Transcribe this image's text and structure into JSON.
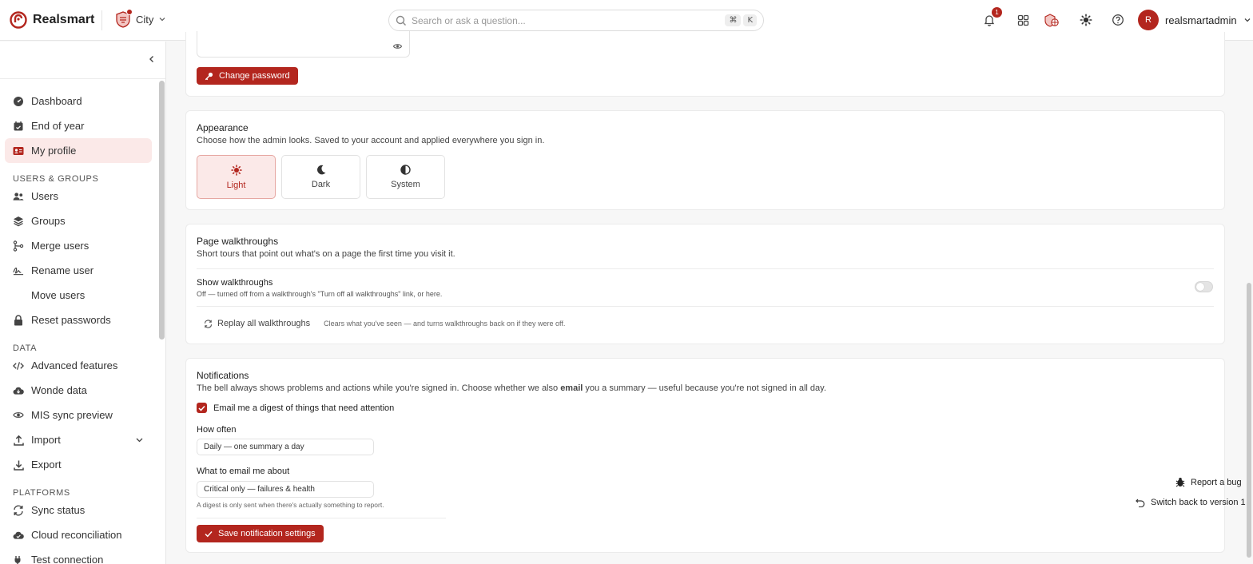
{
  "colors": {
    "accent": "#b3261e",
    "accent_light": "#fbe9e8"
  },
  "header": {
    "brand": "Realsmart",
    "school": "City",
    "search_placeholder": "Search or ask a question...",
    "shortcut_keys": [
      "⌘",
      "K"
    ],
    "notification_count": "1",
    "avatar_initial": "R",
    "username": "realsmartadmin"
  },
  "sidebar": {
    "items_top": [
      {
        "label": "Dashboard",
        "icon": "gauge-icon"
      },
      {
        "label": "End of year",
        "icon": "calendar-check-icon"
      },
      {
        "label": "My profile",
        "icon": "id-card-icon",
        "active": true
      }
    ],
    "section_users": "USERS & GROUPS",
    "items_users": [
      {
        "label": "Users",
        "icon": "users-icon"
      },
      {
        "label": "Groups",
        "icon": "layers-icon"
      },
      {
        "label": "Merge users",
        "icon": "merge-icon"
      },
      {
        "label": "Rename user",
        "icon": "signature-icon"
      },
      {
        "label": "Move users",
        "icon": ""
      },
      {
        "label": "Reset passwords",
        "icon": "lock-icon"
      }
    ],
    "section_data": "DATA",
    "items_data": [
      {
        "label": "Advanced features",
        "icon": "code-icon"
      },
      {
        "label": "Wonde data",
        "icon": "cloud-download-icon"
      },
      {
        "label": "MIS sync preview",
        "icon": "eye-icon"
      },
      {
        "label": "Import",
        "icon": "upload-icon"
      },
      {
        "label": "Export",
        "icon": "download-icon"
      }
    ],
    "section_platforms": "PLATFORMS",
    "items_platforms": [
      {
        "label": "Sync status",
        "icon": "sync-icon"
      },
      {
        "label": "Cloud reconciliation",
        "icon": "cloud-check-icon"
      },
      {
        "label": "Test connection",
        "icon": "plug-icon"
      }
    ]
  },
  "password": {
    "change_button": "Change password"
  },
  "appearance": {
    "title": "Appearance",
    "subtitle": "Choose how the admin looks. Saved to your account and applied everywhere you sign in.",
    "options": [
      "Light",
      "Dark",
      "System"
    ],
    "selected": "Light"
  },
  "walkthroughs": {
    "title": "Page walkthroughs",
    "subtitle": "Short tours that point out what's on a page the first time you visit it.",
    "show_label": "Show walkthroughs",
    "show_hint": "Off — turned off from a walkthrough's \"Turn off all walkthroughs\" link, or here.",
    "show_enabled": false,
    "replay_label": "Replay all walkthroughs",
    "replay_hint": "Clears what you've seen — and turns walkthroughs back on if they were off."
  },
  "notifications": {
    "title": "Notifications",
    "subtitle_before": "The bell always shows problems and actions while you're signed in. Choose whether we also ",
    "subtitle_bold": "email",
    "subtitle_after": " you a summary — useful because you're not signed in all day.",
    "digest_label": "Email me a digest of things that need attention",
    "digest_checked": true,
    "frequency_label": "How often",
    "frequency_value": "Daily — one summary a day",
    "topic_label": "What to email me about",
    "topic_value": "Critical only — failures & health",
    "footnote": "A digest is only sent when there's actually something to report.",
    "save_button": "Save notification settings"
  },
  "floating": {
    "report_bug": "Report a bug",
    "switch_version": "Switch back to version 1"
  }
}
